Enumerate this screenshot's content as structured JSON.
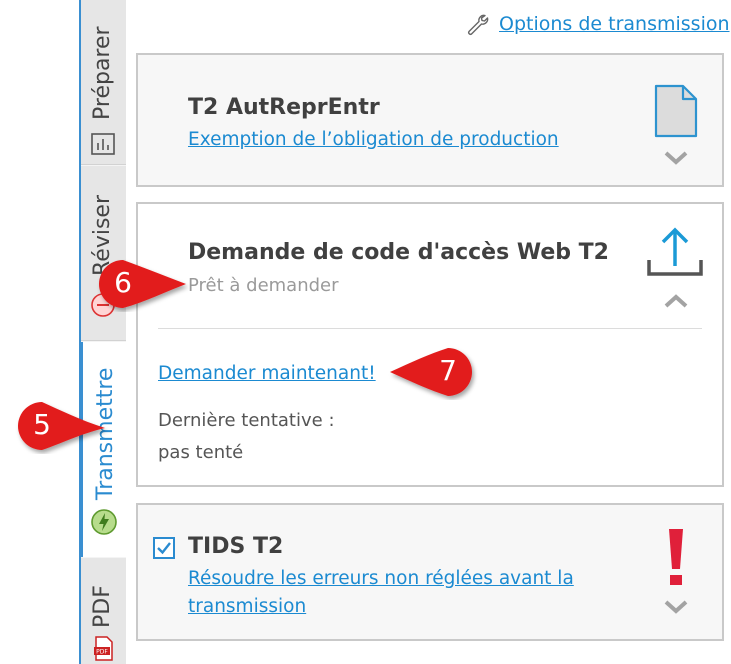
{
  "sidebar": {
    "tabs": [
      {
        "label": "Préparer",
        "icon": "chart-document-icon"
      },
      {
        "label": "Réviser",
        "icon": "review-icon"
      },
      {
        "label": "Transmettre",
        "icon": "lightning-icon"
      },
      {
        "label": "PDF",
        "icon": "pdf-icon"
      }
    ]
  },
  "header": {
    "options_link": "Options de transmission",
    "options_icon": "wrench-icon"
  },
  "cards": [
    {
      "title": "T2 AutReprEntr",
      "link": "Exemption de l’obligation de production",
      "icon": "document-icon",
      "toggle_icon": "chevron-down-icon"
    },
    {
      "title": "Demande de code d'accès Web T2",
      "subtitle": "Prêt à demander",
      "icon": "upload-icon",
      "toggle_icon": "chevron-up-icon",
      "action_link": "Demander maintenant!",
      "last_attempt_label": "Dernière tentative :",
      "last_attempt_value": "pas tenté"
    },
    {
      "title": "TIDS T2",
      "checked": true,
      "link_line1": "Résoudre les erreurs non réglées avant la",
      "link_line2": "transmission",
      "icon": "exclamation-icon",
      "toggle_icon": "chevron-down-icon"
    }
  ],
  "callouts": [
    "5",
    "6",
    "7"
  ],
  "colors": {
    "accent": "#1b8ad1",
    "callout": "#e21b1b",
    "error": "#e0203a"
  }
}
